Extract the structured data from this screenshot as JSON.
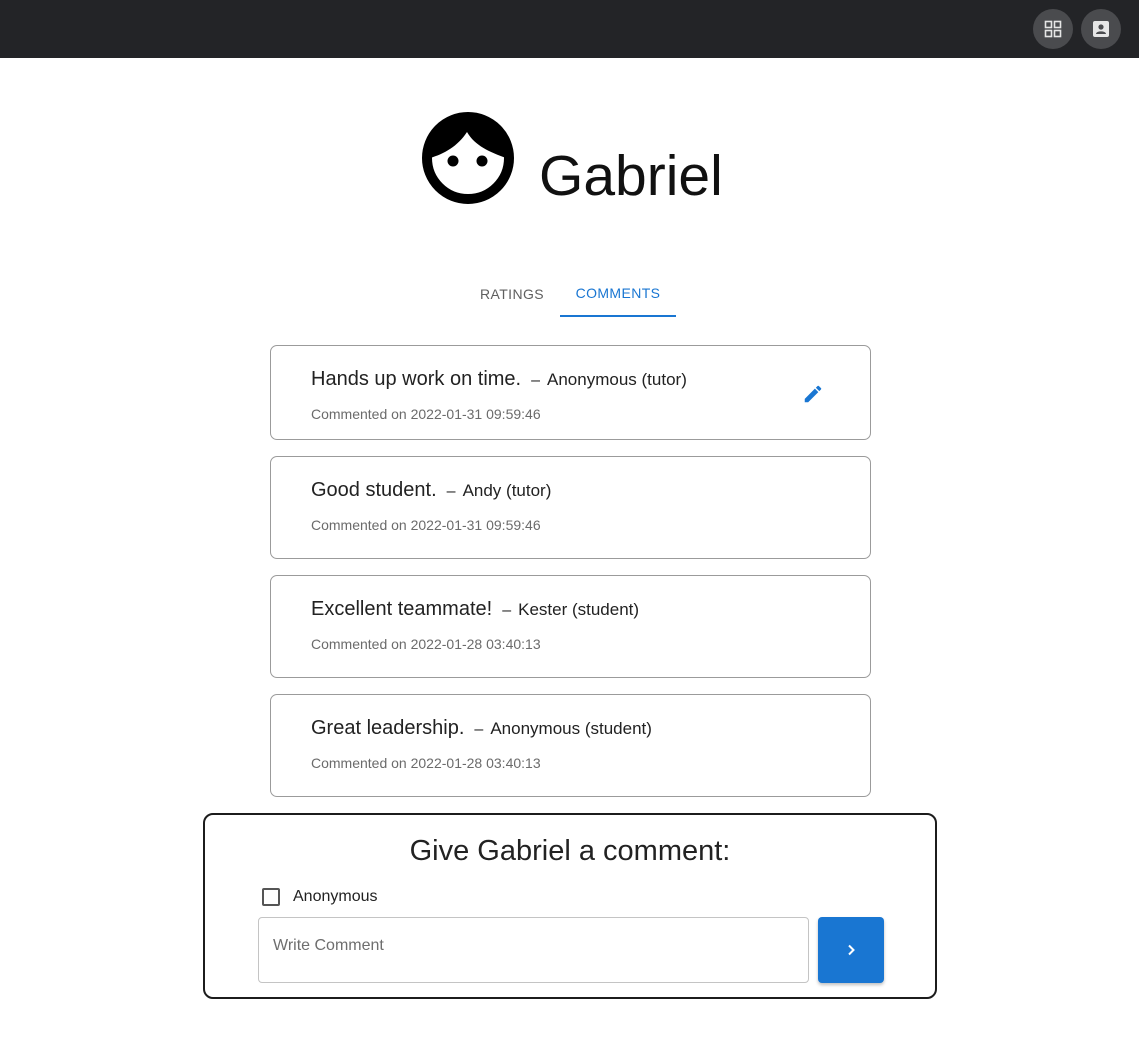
{
  "topbar": {
    "apps_icon": "apps-grid-icon",
    "profile_icon": "contact-card-icon"
  },
  "profile": {
    "avatar_icon": "face-icon",
    "name": "Gabriel"
  },
  "tabs": [
    {
      "label": "RATINGS",
      "selected": false
    },
    {
      "label": "COMMENTS",
      "selected": true
    }
  ],
  "comments": [
    {
      "text": "Hands up work on time.",
      "dash": "–",
      "author": "Anonymous (tutor)",
      "date": "Commented on 2022-01-31 09:59:46",
      "editable": true
    },
    {
      "text": "Good student.",
      "dash": "–",
      "author": "Andy (tutor)",
      "date": "Commented on 2022-01-31 09:59:46",
      "editable": false
    },
    {
      "text": "Excellent teammate!",
      "dash": "–",
      "author": "Kester (student)",
      "date": "Commented on 2022-01-28 03:40:13",
      "editable": false
    },
    {
      "text": "Great leadership.",
      "dash": "–",
      "author": "Anonymous (student)",
      "date": "Commented on 2022-01-28 03:40:13",
      "editable": false
    }
  ],
  "composer": {
    "title": "Give Gabriel a comment:",
    "anonymous_label": "Anonymous",
    "anonymous_checked": false,
    "placeholder": "Write Comment",
    "value": "",
    "send_icon": "chevron-right-icon"
  },
  "colors": {
    "topbar": "#232427",
    "accent": "#1976d2",
    "card_border": "#9b9b9b"
  }
}
